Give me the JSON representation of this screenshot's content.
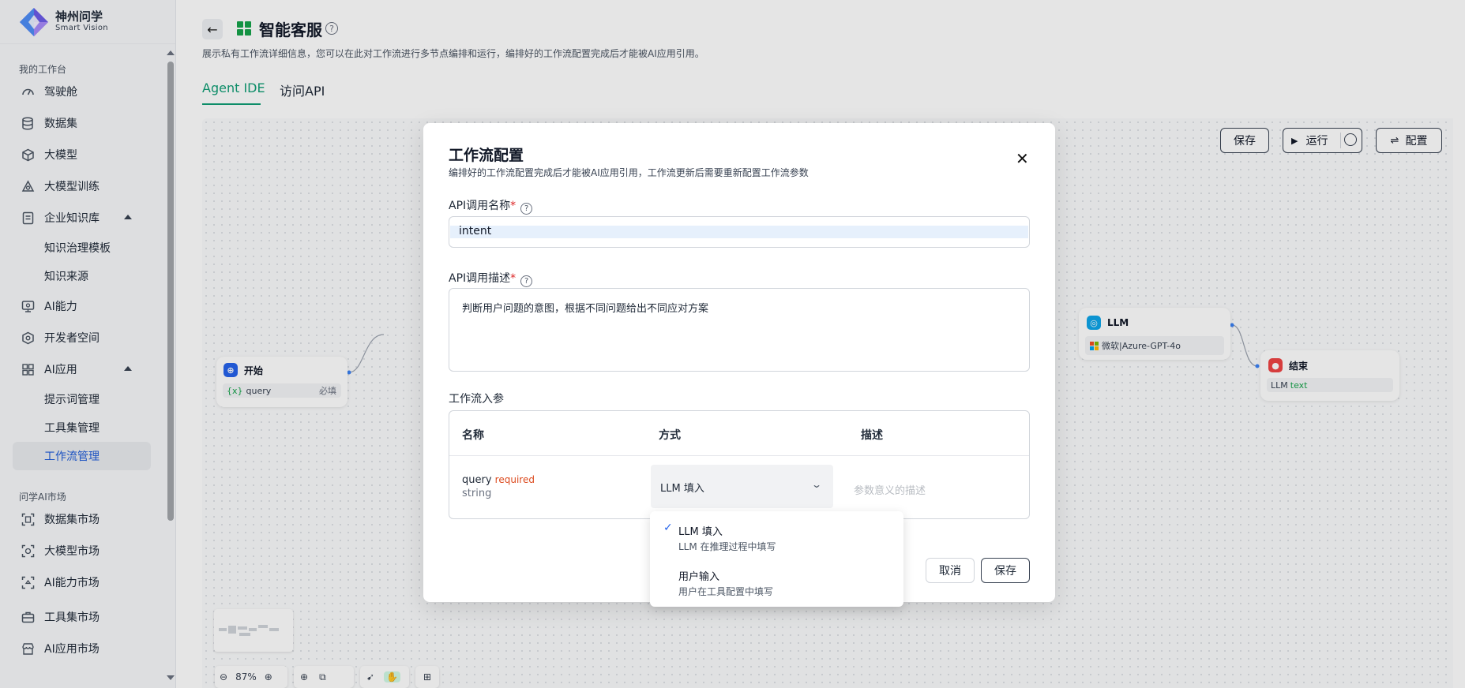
{
  "brand": {
    "name": "神州问学",
    "sub": "Smart Vision"
  },
  "sidebar": {
    "section1": "我的工作台",
    "items": [
      {
        "label": "驾驶舱",
        "icon": "dashboard-icon"
      },
      {
        "label": "数据集",
        "icon": "database-icon"
      },
      {
        "label": "大模型",
        "icon": "cube-icon"
      },
      {
        "label": "大模型训练",
        "icon": "training-icon"
      },
      {
        "label": "企业知识库",
        "icon": "knowledge-icon"
      },
      {
        "label": "知识治理模板"
      },
      {
        "label": "知识来源"
      },
      {
        "label": "AI能力",
        "icon": "ai-ability-icon"
      },
      {
        "label": "开发者空间",
        "icon": "developer-icon"
      },
      {
        "label": "AI应用",
        "icon": "apps-icon"
      },
      {
        "label": "提示词管理"
      },
      {
        "label": "工具集管理"
      },
      {
        "label": "工作流管理"
      }
    ],
    "section2": "问学AI市场",
    "market": [
      {
        "label": "数据集市场"
      },
      {
        "label": "大模型市场"
      },
      {
        "label": "AI能力市场"
      },
      {
        "label": "工具集市场"
      },
      {
        "label": "AI应用市场"
      }
    ]
  },
  "header": {
    "title": "智能客服",
    "desc": "展示私有工作流详细信息，您可以在此对工作流进行多节点编排和运行，编排好的工作流配置完成后才能被AI应用引用。",
    "tabs": [
      "Agent IDE",
      "访问API"
    ]
  },
  "canvas": {
    "toolbar": {
      "save": "保存",
      "run": "运行",
      "config": "配置"
    },
    "nodes": {
      "start": {
        "title": "开始",
        "var_prefix": "{x}",
        "var": "query",
        "req": "必填"
      },
      "llm": {
        "title": "LLM",
        "model": "微软|Azure-GPT-4o"
      },
      "end": {
        "title": "结束",
        "src": "LLM",
        "field": "text"
      }
    },
    "zoom": "87%"
  },
  "modal": {
    "title": "工作流配置",
    "subtitle": "编排好的工作流配置完成后才能被AI应用引用，工作流更新后需要重新配置工作流参数",
    "api_name_label": "API调用名称",
    "api_name_value": "intent",
    "api_desc_label": "API调用描述",
    "api_desc_value": "判断用户问题的意图，根据不同问题给出不同应对方案",
    "params_label": "工作流入参",
    "table": {
      "headers": [
        "名称",
        "方式",
        "描述"
      ],
      "row": {
        "name": "query",
        "required": "required",
        "type": "string",
        "mode": "LLM 填入",
        "desc_placeholder": "参数意义的描述"
      }
    },
    "cancel": "取消",
    "save": "保存"
  },
  "dropdown": {
    "options": [
      {
        "title": "LLM 填入",
        "desc": "LLM 在推理过程中填写",
        "selected": true
      },
      {
        "title": "用户输入",
        "desc": "用户在工具配置中填写",
        "selected": false
      }
    ]
  },
  "colors": {
    "accent": "#0f9d74",
    "link": "#1d5bd8",
    "required": "#dc2626",
    "check": "#2563eb"
  }
}
